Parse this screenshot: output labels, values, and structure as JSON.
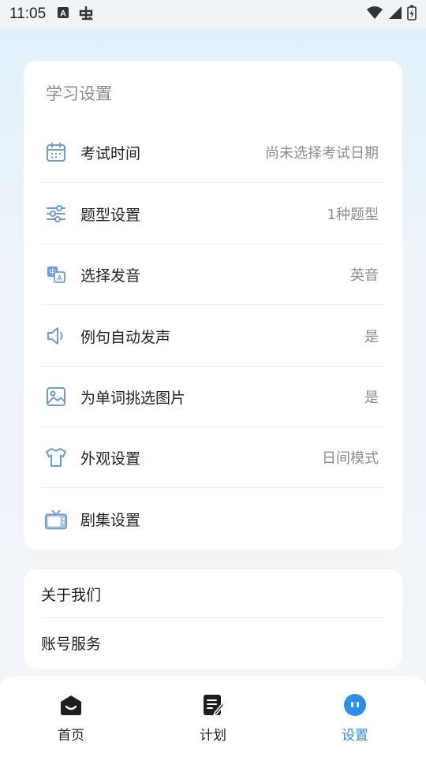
{
  "status_bar": {
    "time": "11:05"
  },
  "settings_card": {
    "title": "学习设置",
    "rows": [
      {
        "icon": "calendar-icon",
        "label": "考试时间",
        "value": "尚未选择考试日期"
      },
      {
        "icon": "sliders-icon",
        "label": "题型设置",
        "value": "1种题型"
      },
      {
        "icon": "translate-icon",
        "label": "选择发音",
        "value": "英音"
      },
      {
        "icon": "speaker-icon",
        "label": "例句自动发声",
        "value": "是"
      },
      {
        "icon": "image-icon",
        "label": "为单词挑选图片",
        "value": "是"
      },
      {
        "icon": "tshirt-icon",
        "label": "外观设置",
        "value": "日间模式"
      },
      {
        "icon": "tv-icon",
        "label": "剧集设置",
        "value": ""
      }
    ]
  },
  "about_card": {
    "items": [
      {
        "label": "关于我们"
      },
      {
        "label": "账号服务"
      }
    ]
  },
  "bottom_nav": {
    "items": [
      {
        "label": "首页",
        "icon": "home-icon",
        "active": false
      },
      {
        "label": "计划",
        "icon": "plan-icon",
        "active": false
      },
      {
        "label": "设置",
        "icon": "settings-face-icon",
        "active": true
      }
    ]
  },
  "colors": {
    "accent": "#2a8fe8",
    "icon_blue": "#6c9be0"
  }
}
